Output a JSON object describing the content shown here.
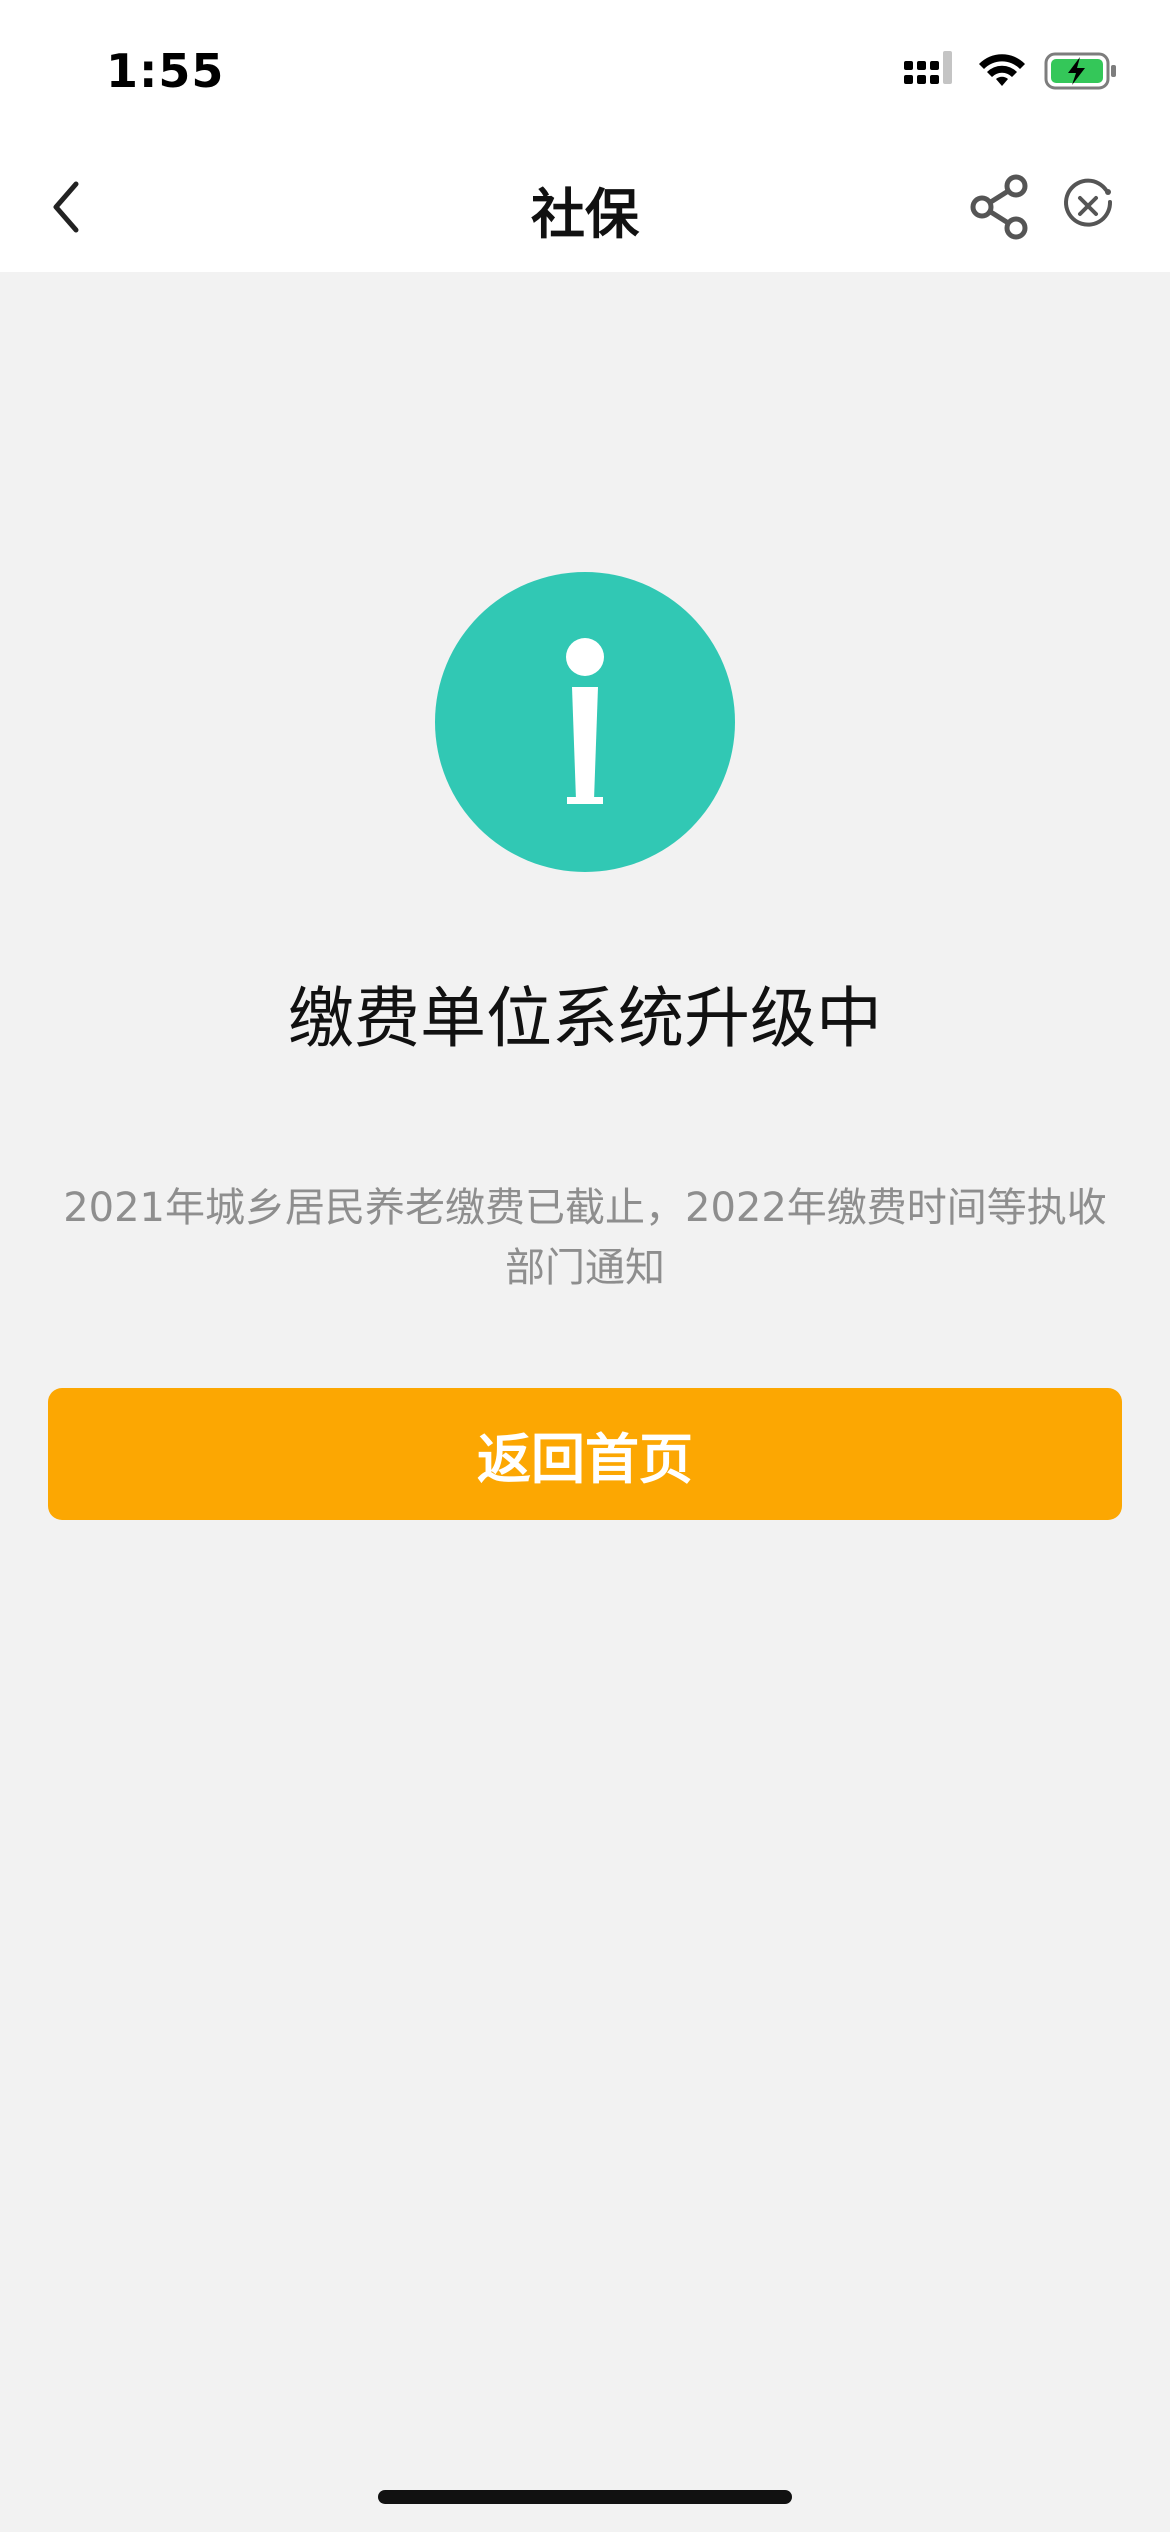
{
  "status_bar": {
    "time": "1:55",
    "icons": [
      "cellular-signal-icon",
      "wifi-icon",
      "battery-charging-icon"
    ],
    "battery_color": "#34c759"
  },
  "nav": {
    "title": "社保",
    "back_icon": "chevron-left-icon",
    "share_icon": "share-icon",
    "close_icon": "close-circle-icon"
  },
  "main": {
    "status_icon": "info-icon",
    "icon_color": "#31c8b4",
    "headline": "缴费单位系统升级中",
    "message_line1": "2021年城乡居民养老缴费已截止，2022年缴费时间等执收",
    "message_line2": "部门通知",
    "button_label": "返回首页",
    "button_color": "#fca702"
  }
}
